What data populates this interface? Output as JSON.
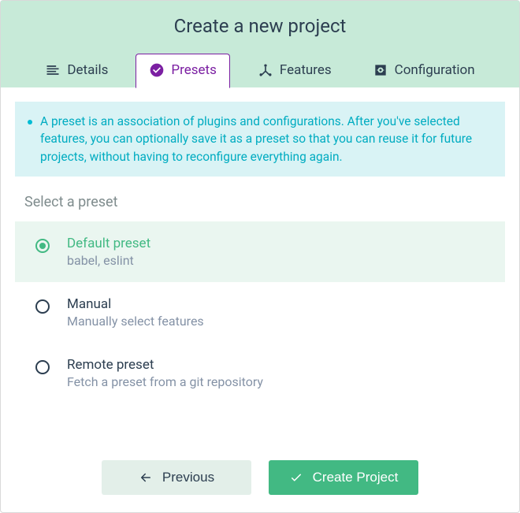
{
  "header": {
    "title": "Create a new project"
  },
  "tabs": [
    {
      "label": "Details"
    },
    {
      "label": "Presets"
    },
    {
      "label": "Features"
    },
    {
      "label": "Configuration"
    }
  ],
  "info": {
    "text": "A preset is an association of plugins and configurations. After you've selected features, you can optionally save it as a preset so that you can reuse it for future projects, without having to reconfigure everything again."
  },
  "section": {
    "heading": "Select a preset"
  },
  "options": [
    {
      "title": "Default preset",
      "subtitle": "babel, eslint",
      "selected": true
    },
    {
      "title": "Manual",
      "subtitle": "Manually select features",
      "selected": false
    },
    {
      "title": "Remote preset",
      "subtitle": "Fetch a preset from a git repository",
      "selected": false
    }
  ],
  "footer": {
    "previous_label": "Previous",
    "create_label": "Create Project"
  }
}
